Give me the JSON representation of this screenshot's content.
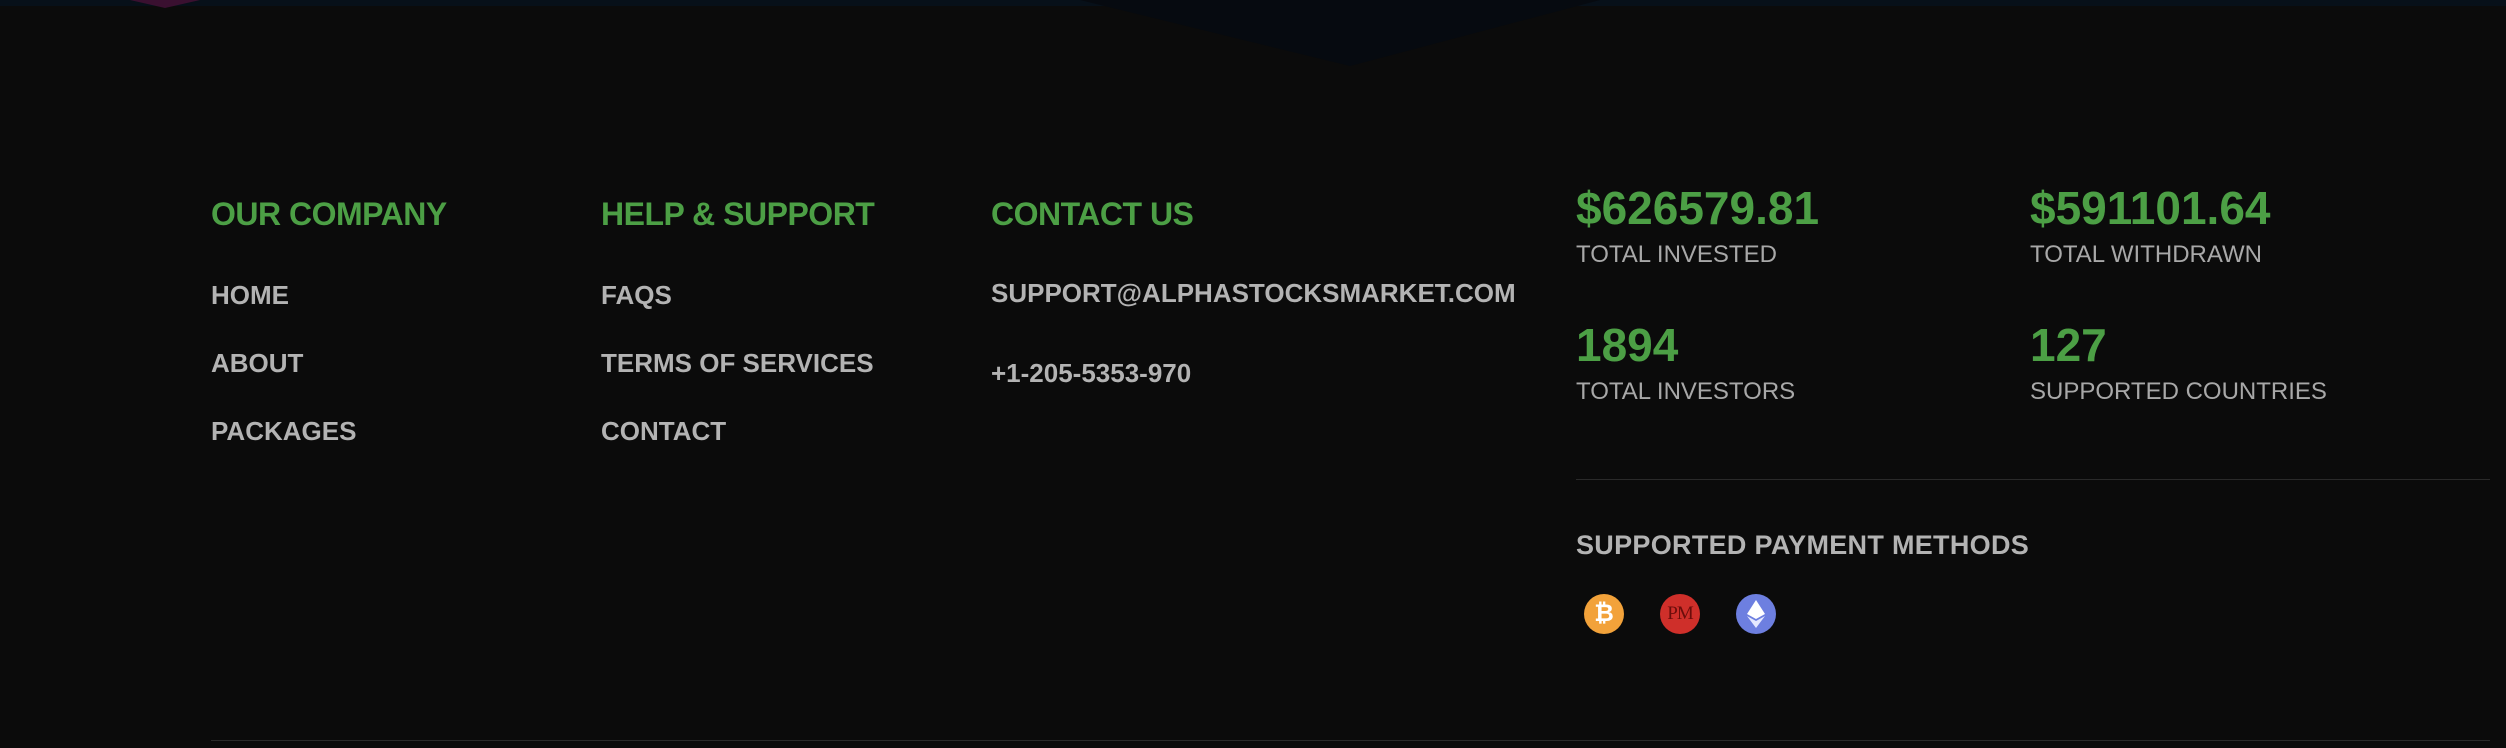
{
  "footer": {
    "columns": [
      {
        "heading": "OUR COMPANY",
        "links": [
          {
            "label": "HOME"
          },
          {
            "label": "ABOUT"
          },
          {
            "label": "PACKAGES"
          }
        ]
      },
      {
        "heading": "HELP & SUPPORT",
        "links": [
          {
            "label": "FAQS"
          },
          {
            "label": "TERMS OF SERVICES"
          },
          {
            "label": "CONTACT"
          }
        ]
      },
      {
        "heading": "CONTACT US",
        "email": "SUPPORT@ALPHASTOCKSMARKET.COM",
        "phone": "+1-205-5353-970"
      }
    ],
    "stats": [
      {
        "value": "$626579.81",
        "label": "TOTAL INVESTED"
      },
      {
        "value": "$591101.64",
        "label": "TOTAL WITHDRAWN"
      },
      {
        "value": "1894",
        "label": "TOTAL INVESTORS"
      },
      {
        "value": "127",
        "label": "SUPPORTED COUNTRIES"
      }
    ],
    "payment": {
      "title": "SUPPORTED PAYMENT METHODS",
      "methods": [
        {
          "icon": "bitcoin-icon",
          "glyph": "₿",
          "color": "#f2a23a"
        },
        {
          "icon": "perfect-money-icon",
          "glyph": "PM",
          "color": "#cf2f2a"
        },
        {
          "icon": "ethereum-icon",
          "color": "#6d7fe0"
        }
      ]
    },
    "colors": {
      "background": "#0b0b0b",
      "accent": "#4c9f45",
      "link_text": "#b3b3b3",
      "divider": "#2a2a2a"
    }
  }
}
